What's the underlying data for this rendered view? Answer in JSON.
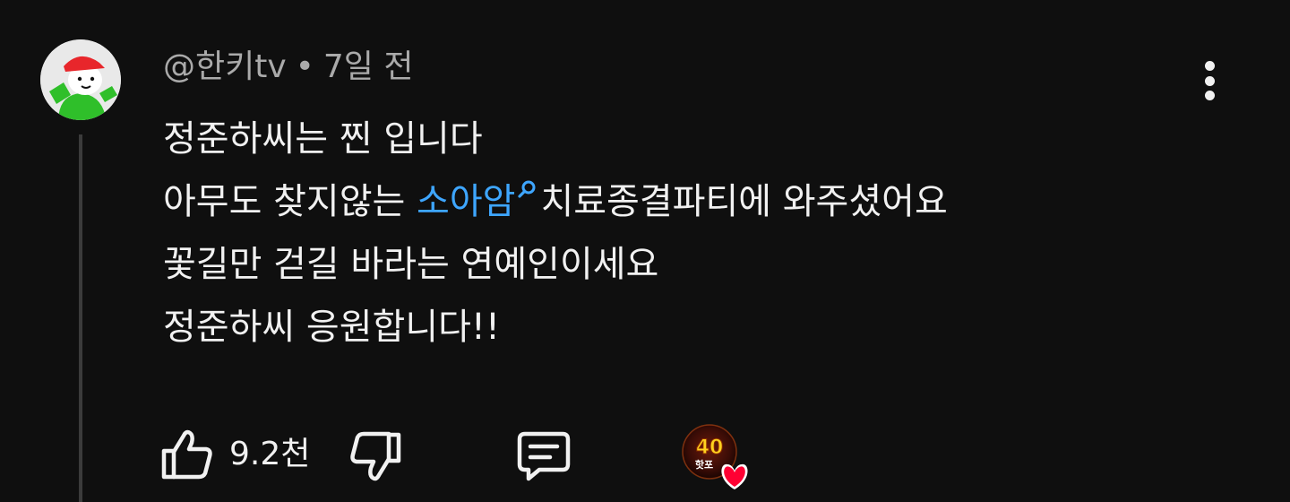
{
  "comment": {
    "author": "@한키tv",
    "separator": "•",
    "time": "7일 전",
    "lines": {
      "l1": "정준하씨는 찐 입니다",
      "l2_before": "아무도 찾지않는 ",
      "l2_link": "소아암",
      "l2_after": "치료종결파티에 와주셨어요",
      "l3": "꽃길만 걷길 바라는 연예인이세요",
      "l4": "정준하씨 응원합니다!!"
    }
  },
  "actions": {
    "like_count": "9.2천",
    "creator_badge_text": "40",
    "creator_badge_subtext": "핫포"
  },
  "icons": {
    "like": "thumbs-up-icon",
    "dislike": "thumbs-down-icon",
    "reply": "comment-icon",
    "menu": "more-vertical-icon",
    "search": "search-icon",
    "heart": "heart-icon"
  },
  "colors": {
    "background": "#0f0f0f",
    "text": "#f1f1f1",
    "secondary": "#aaaaaa",
    "link": "#3ea6ff",
    "heart": "#ff0033"
  }
}
